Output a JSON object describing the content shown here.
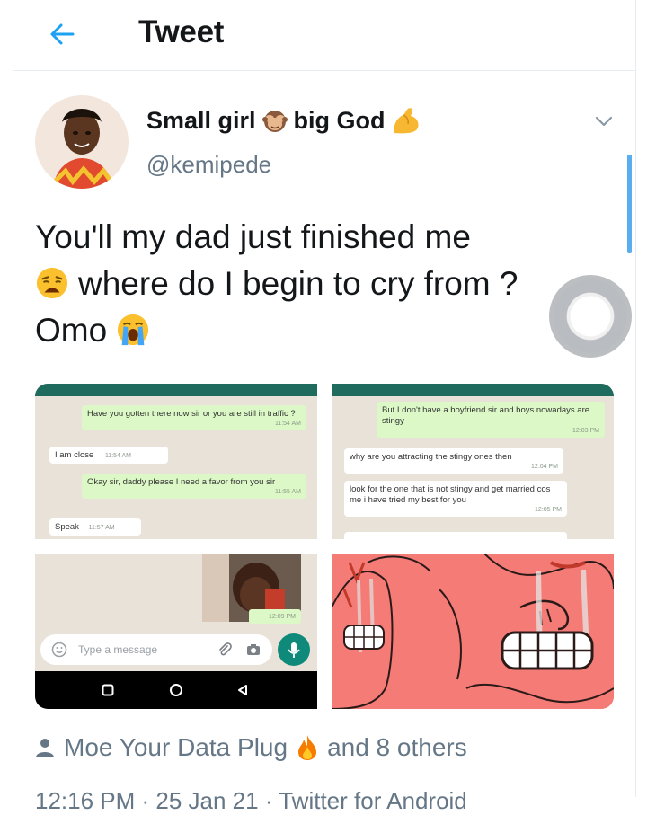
{
  "header": {
    "title": "Tweet"
  },
  "tweet": {
    "author_name": "Small girl",
    "author_name_suffix": "big God",
    "handle": "@kemipede",
    "text_line1": "You'll my dad just finished me",
    "text_line2": "where do I begin to cry from ?",
    "text_line3": "Omo"
  },
  "chat1": {
    "msg1": "Have you gotten there now sir or you are still in traffic ?",
    "msg1_time": "11:54 AM",
    "msg2": "I am close",
    "msg2_time": "11:54 AM",
    "msg3": "Okay sir, daddy please I need a favor from you sir",
    "msg3_time": "11:55 AM",
    "msg4": "Speak",
    "msg4_time": "11:57 AM"
  },
  "chat2": {
    "msg1": "But I don't have a boyfriend sir and boys nowadays are stingy",
    "msg1_time": "12:03 PM",
    "msg2": "why are you attracting the stingy ones then",
    "msg2_time": "12:04 PM",
    "msg3": "look for the one that is not stingy and get married cos me i have tried my best for you",
    "msg3_time": "12:05 PM"
  },
  "chat3": {
    "photo_time": "12:09 PM",
    "input_placeholder": "Type a message"
  },
  "likes": {
    "liker": "Moe Your Data Plug",
    "others": "and 8 others"
  },
  "footer": {
    "partial_text": "12:16 PM · 25 Jan 21 · Twitter for Android"
  },
  "colors": {
    "accent": "#1da1f2",
    "secondary_text": "#657786",
    "wa_header": "#1f6b5d",
    "wa_out": "#dcf8c6",
    "meme_bg": "#f57b76"
  },
  "icons": [
    "back-arrow-icon",
    "chevron-down-icon",
    "see-no-evil-monkey-emoji",
    "flexed-biceps-emoji",
    "weary-face-emoji",
    "loudly-crying-face-emoji",
    "person-icon",
    "fire-emoji"
  ]
}
